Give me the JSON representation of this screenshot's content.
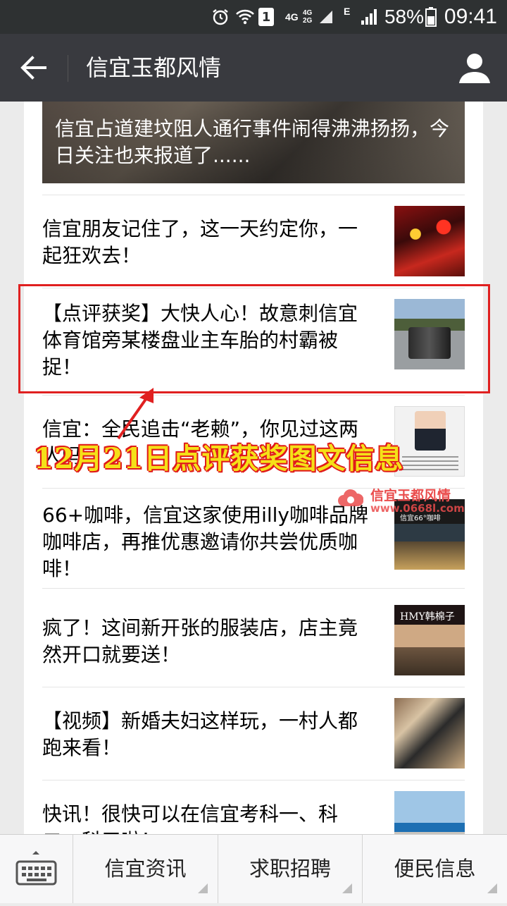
{
  "status_bar": {
    "network_a": "4G",
    "network_b_top": "4G",
    "network_b_bottom": "2G",
    "network_c": "E",
    "sim": "1",
    "battery": "58%",
    "time": "09:41"
  },
  "header": {
    "title": "信宜玉都风情"
  },
  "feature": {
    "title": "信宜占道建坟阻人通行事件闹得沸沸扬扬，今日关注也来报道了......"
  },
  "articles": [
    {
      "title": "信宜朋友记住了，这一天约定你，一起狂欢去！",
      "thumb": "party-thumbnail"
    },
    {
      "title": "【点评获奖】大快人心！故意刺信宜体育馆旁某楼盘业主车胎的村霸被捉！",
      "thumb": "road-scene-thumbnail"
    },
    {
      "title": "信宜：全民追击“老赖”，你见过这两人吗",
      "thumb": "id-card-thumbnail"
    },
    {
      "title": "66+咖啡，信宜这家使用illy咖啡品牌咖啡店，再推优惠邀请你共尝优质咖啡！",
      "thumb": "cafe-thumbnail"
    },
    {
      "title": "疯了！这间新开张的服装店，店主竟然开口就要送！",
      "thumb": "shop-thumbnail"
    },
    {
      "title": "【视频】新婚夫妇这样玩，一村人都跑来看！",
      "thumb": "wedding-thumbnail"
    },
    {
      "title": "快讯！很快可以在信宜考科一、科二、科三啦！",
      "thumb": "highway-thumbnail"
    }
  ],
  "annotation": {
    "caption": "12月21日点评获奖图文信息",
    "color_box": "#e02020",
    "color_text": "#f5e018"
  },
  "watermark": {
    "name": "信宜玉都风情",
    "url": "www.0668l.com"
  },
  "bottom_menu": {
    "items": [
      {
        "label": "信宜资讯"
      },
      {
        "label": "求职招聘"
      },
      {
        "label": "便民信息"
      }
    ]
  }
}
